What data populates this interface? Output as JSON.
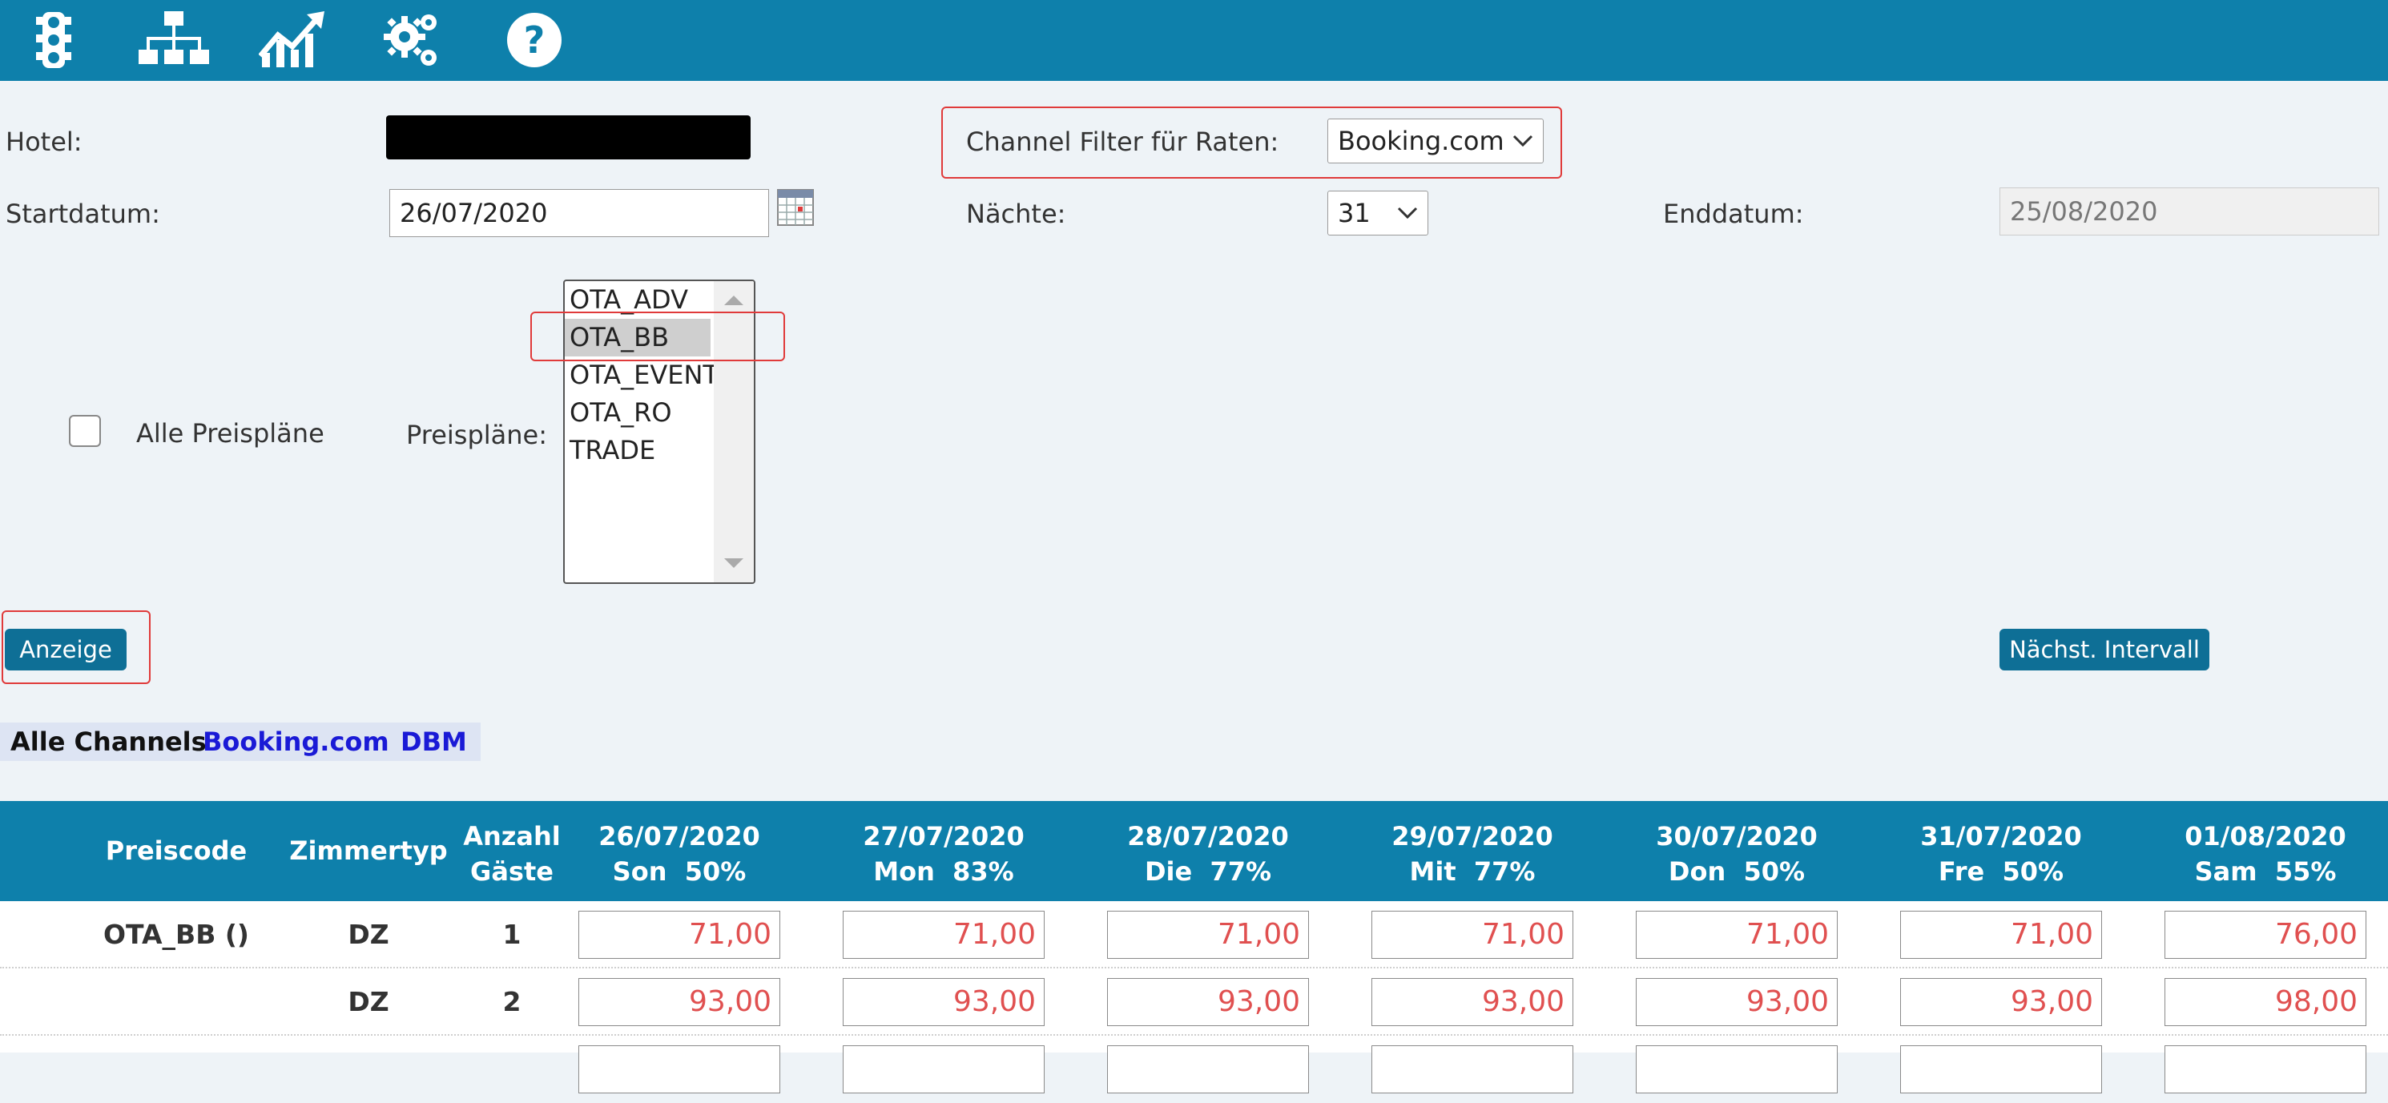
{
  "toolbar": {
    "icons": [
      "traffic-light-icon",
      "sitemap-icon",
      "chart-trend-icon",
      "gears-icon",
      "help-icon"
    ]
  },
  "form": {
    "hotel_label": "Hotel:",
    "channel_filter_label": "Channel Filter für Raten:",
    "channel_filter_value": "Booking.com",
    "start_label": "Startdatum:",
    "start_value": "26/07/2020",
    "nights_label": "Nächte:",
    "nights_value": "31",
    "end_label": "Enddatum:",
    "end_value": "25/08/2020",
    "all_plans_label": "Alle Preispläne",
    "plans_label": "Preispläne:",
    "plans": [
      "OTA_ADV",
      "OTA_BB",
      "OTA_EVENT",
      "OTA_RO",
      "TRADE"
    ],
    "selected_plan": "OTA_BB"
  },
  "buttons": {
    "show": "Anzeige",
    "next_interval": "Nächst. Intervall"
  },
  "channels": {
    "all": "Alle Channels",
    "booking": "Booking.com",
    "dbm": "DBM"
  },
  "table": {
    "headers": {
      "code": "Preiscode",
      "room": "Zimmertyp",
      "guests_line1": "Anzahl",
      "guests_line2": "Gäste"
    },
    "dates": [
      {
        "date": "26/07/2020",
        "day": "Son  50%"
      },
      {
        "date": "27/07/2020",
        "day": "Mon  83%"
      },
      {
        "date": "28/07/2020",
        "day": "Die  77%"
      },
      {
        "date": "29/07/2020",
        "day": "Mit  77%"
      },
      {
        "date": "30/07/2020",
        "day": "Don  50%"
      },
      {
        "date": "31/07/2020",
        "day": "Fre  50%"
      },
      {
        "date": "01/08/2020",
        "day": "Sam  55%"
      }
    ],
    "rows": [
      {
        "code": "OTA_BB ()",
        "room": "DZ",
        "guests": "1",
        "prices": [
          "71,00",
          "71,00",
          "71,00",
          "71,00",
          "71,00",
          "71,00",
          "76,00"
        ]
      },
      {
        "code": "",
        "room": "DZ",
        "guests": "2",
        "prices": [
          "93,00",
          "93,00",
          "93,00",
          "93,00",
          "93,00",
          "93,00",
          "98,00"
        ]
      }
    ]
  },
  "colors": {
    "header_bg": "#0e80ab",
    "button_bg": "#0e6f96",
    "highlight": "#e03a3a",
    "price_text": "#e05050",
    "link": "#1a1ad6"
  }
}
